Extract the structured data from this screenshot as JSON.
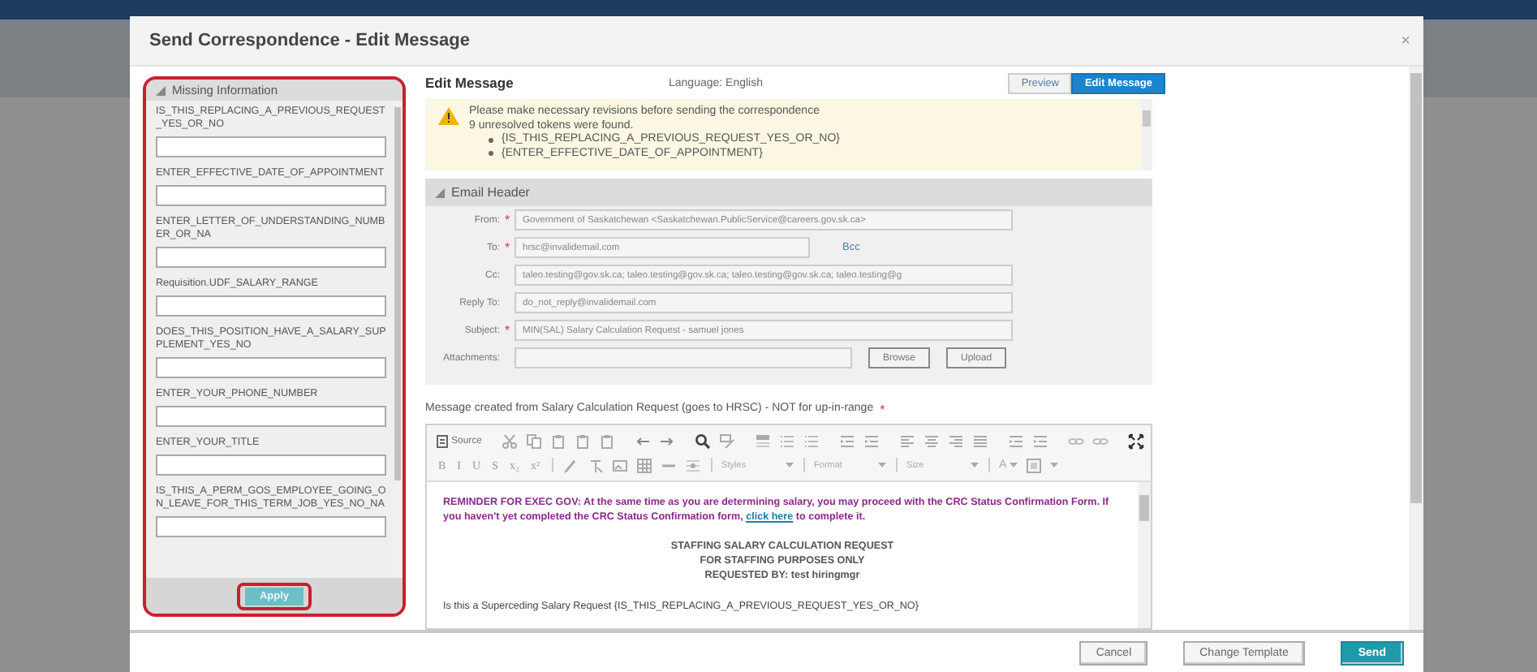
{
  "dialog": {
    "title": "Send Correspondence - Edit Message",
    "close": "×"
  },
  "missing_info": {
    "title": "Missing Information",
    "fields": [
      {
        "label": "IS_THIS_REPLACING_A_PREVIOUS_REQUEST_YES_OR_NO"
      },
      {
        "label": "ENTER_EFFECTIVE_DATE_OF_APPOINTMENT"
      },
      {
        "label": "ENTER_LETTER_OF_UNDERSTANDING_NUMBER_OR_NA"
      },
      {
        "label": "Requisition.UDF_SALARY_RANGE"
      },
      {
        "label": "DOES_THIS_POSITION_HAVE_A_SALARY_SUPPLEMENT_YES_NO"
      },
      {
        "label": "ENTER_YOUR_PHONE_NUMBER"
      },
      {
        "label": "ENTER_YOUR_TITLE"
      },
      {
        "label": "IS_THIS_A_PERM_GOS_EMPLOYEE_GOING_ON_LEAVE_FOR_THIS_TERM_JOB_YES_NO_NA"
      }
    ],
    "apply": "Apply"
  },
  "edit": {
    "title": "Edit Message",
    "language": "Language: English",
    "tabs": [
      {
        "label": "Preview",
        "selected": false
      },
      {
        "label": "Edit Message",
        "selected": true
      }
    ],
    "warning": {
      "lines": [
        "Please make necessary revisions before sending the correspondence",
        "9 unresolved tokens were found."
      ],
      "tokens": [
        "{IS_THIS_REPLACING_A_PREVIOUS_REQUEST_YES_OR_NO}",
        "{ENTER_EFFECTIVE_DATE_OF_APPOINTMENT}"
      ]
    },
    "email_header": {
      "title": "Email Header",
      "fields": [
        {
          "kind": "field",
          "label": "From:",
          "required_mark": "*",
          "value": "Government of Saskatchewan <Saskatchewan.PublicService@careers.gov.sk.ca>"
        },
        {
          "kind": "field",
          "label": "To:",
          "required_mark": "*",
          "value": "hrsc@invalidemail.com",
          "link": "Bcc"
        },
        {
          "kind": "field",
          "label": "Cc:",
          "value": "taleo.testing@gov.sk.ca; taleo.testing@gov.sk.ca; taleo.testing@gov.sk.ca; taleo.testing@g"
        },
        {
          "kind": "field",
          "label": "Reply To:",
          "value": "do_not_reply@invalidemail.com"
        },
        {
          "kind": "field",
          "label": "Subject:",
          "required_mark": "*",
          "value": "MIN(SAL) Salary Calculation Request - samuel jones"
        },
        {
          "kind": "upload",
          "label": "Attachments:",
          "buttons": [
            "Browse",
            "Upload"
          ]
        }
      ]
    },
    "message_label": "Message created from Salary Calculation Request (goes to HRSC) - NOT for up-in-range",
    "message_required_mark": "*",
    "editor": {
      "source": "Source",
      "format_buttons": [
        "B",
        "I",
        "U",
        "S",
        "x₂",
        "x²"
      ],
      "combos": [
        "Styles",
        "Format",
        "Size"
      ],
      "font_color": "A",
      "reminder": {
        "before": "REMINDER FOR EXEC GOV:  At the same time as you are determining salary, you may proceed with the CRC Status Confirmation Form.  If you haven't yet completed the CRC Status Confirmation form, ",
        "link": "click here",
        "after": " to complete it."
      },
      "heading_lines": [
        "STAFFING SALARY CALCULATION REQUEST",
        "FOR STAFFING PURPOSES ONLY",
        "REQUESTED BY:  test hiringmgr"
      ],
      "body_line": "Is this a Superceding Salary Request   {IS_THIS_REPLACING_A_PREVIOUS_REQUEST_YES_OR_NO}"
    }
  },
  "footer": {
    "buttons": [
      {
        "label": "Cancel",
        "kind": "default"
      },
      {
        "label": "Change Template",
        "kind": "default"
      },
      {
        "label": "Send",
        "kind": "primary"
      }
    ]
  }
}
